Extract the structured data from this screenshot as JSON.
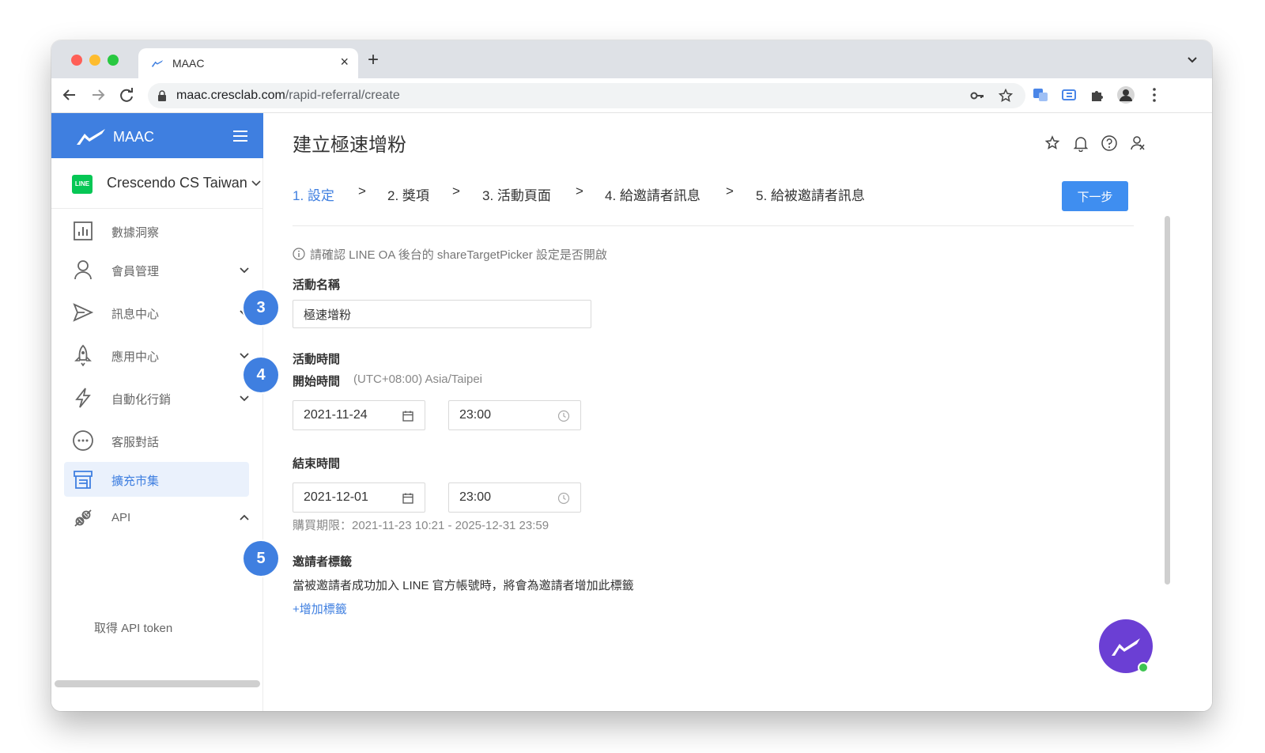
{
  "browser": {
    "tab_title": "MAAC",
    "url_host": "maac.cresclab.com",
    "url_path": "/rapid-referral/create"
  },
  "sidebar": {
    "brand": "MAAC",
    "account": "Crescendo CS Taiwan",
    "line_badge": "LINE",
    "items": [
      {
        "label": "數據洞察",
        "icon": "chart-icon",
        "caret": false
      },
      {
        "label": "會員管理",
        "icon": "user-icon",
        "caret": "down"
      },
      {
        "label": "訊息中心",
        "icon": "send-icon",
        "caret": "down"
      },
      {
        "label": "應用中心",
        "icon": "rocket-icon",
        "caret": "down"
      },
      {
        "label": "自動化行銷",
        "icon": "bolt-icon",
        "caret": "down"
      },
      {
        "label": "客服對話",
        "icon": "chat-bubble-icon",
        "caret": false
      },
      {
        "label": "擴充市集",
        "icon": "store-icon",
        "caret": false,
        "active": true
      },
      {
        "label": "API",
        "icon": "plug-icon",
        "caret": "up"
      }
    ],
    "submenu_item": "取得 API token"
  },
  "main": {
    "page_title": "建立極速增粉",
    "steps": [
      "1. 設定",
      "2. 獎項",
      "3. 活動頁面",
      "4. 給邀請者訊息",
      "5. 給被邀請者訊息"
    ],
    "step_separator": ">",
    "next_button": "下一步",
    "notice": "請確認 LINE OA 後台的 shareTargetPicker 設定是否開啟",
    "name_label": "活動名稱",
    "name_value": "極速增粉",
    "time_label": "活動時間",
    "start_label": "開始時間",
    "timezone": "(UTC+08:00) Asia/Taipei",
    "start_date": "2021-11-24",
    "start_time": "23:00",
    "end_label": "結束時間",
    "end_date": "2021-12-01",
    "end_time": "23:00",
    "purchase_range": "購買期限：2021-11-23 10:21 - 2025-12-31 23:59",
    "tag_label": "邀請者標籤",
    "tag_desc": "當被邀請者成功加入 LINE 官方帳號時，將會為邀請者增加此標籤",
    "add_tag": "+增加標籤"
  },
  "badges": [
    "3",
    "4",
    "5"
  ],
  "colors": {
    "accent": "#3f7fe0",
    "button": "#3f8ef0",
    "chat_fab": "#6b3fd4",
    "line_green": "#06c755"
  }
}
